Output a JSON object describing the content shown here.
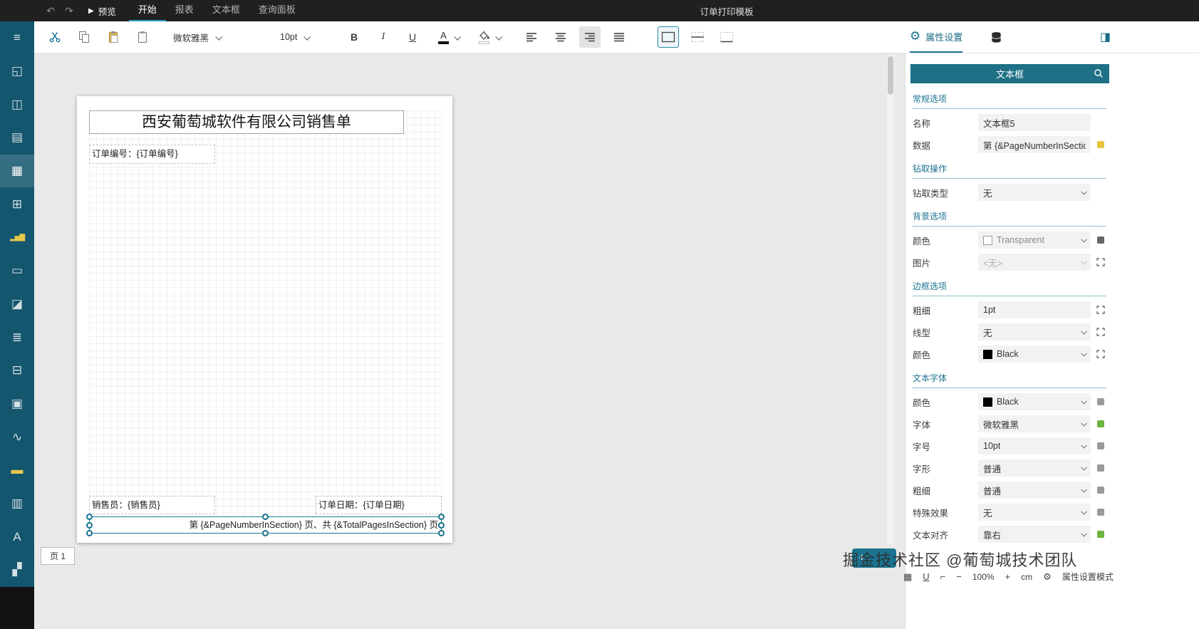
{
  "colors": {
    "accent_teal": "#1b7390",
    "topbar_bg": "#202020",
    "rail_bg": "#14566e",
    "selection": "#1f7c97",
    "chip_yellow": "#e5c63d",
    "chip_green": "#6cb33f"
  },
  "topbar": {
    "preview": "预览",
    "tabs": [
      {
        "label": "开始"
      },
      {
        "label": "报表"
      },
      {
        "label": "文本框"
      },
      {
        "label": "查询面板"
      }
    ],
    "title": "订单打印模板"
  },
  "toolbar": {
    "font_family": "微软雅黑",
    "font_size": "10pt",
    "bold": "B",
    "italic": "I",
    "underline": "U"
  },
  "panel": {
    "header_tab": "属性设置",
    "title": "文本框",
    "groups": [
      {
        "title": "常规选项",
        "rows": [
          {
            "label": "名称",
            "value": "文本框5"
          },
          {
            "label": "数据",
            "value": "第 {&PageNumberInSectio"
          }
        ]
      },
      {
        "title": "钻取操作",
        "rows": [
          {
            "label": "钻取类型",
            "value": "无"
          }
        ]
      },
      {
        "title": "背景选项",
        "rows": [
          {
            "label": "颜色",
            "value": "Transparent"
          },
          {
            "label": "图片",
            "value": "<无>"
          }
        ]
      },
      {
        "title": "边框选项",
        "rows": [
          {
            "label": "粗细",
            "value": "1pt"
          },
          {
            "label": "线型",
            "value": "无"
          },
          {
            "label": "颜色",
            "value": "Black"
          }
        ]
      },
      {
        "title": "文本字体",
        "rows": [
          {
            "label": "颜色",
            "value": "Black"
          },
          {
            "label": "字体",
            "value": "微软雅黑"
          },
          {
            "label": "字号",
            "value": "10pt"
          },
          {
            "label": "字形",
            "value": "普通"
          },
          {
            "label": "粗细",
            "value": "普通"
          },
          {
            "label": "特殊效果",
            "value": "无"
          },
          {
            "label": "文本对齐",
            "value": "靠右"
          }
        ]
      }
    ]
  },
  "canvas": {
    "report_title": "西安葡萄城软件有限公司销售单",
    "order_no": "订单编号：{订单编号}",
    "seller": "销售员：{销售员}",
    "order_date": "订单日期：{订单日期}",
    "page_footer": "第 {&PageNumberInSection} 页、共 {&TotalPagesInSection} 页"
  },
  "bottom": {
    "page_tab": "页 1",
    "zoom": "100%",
    "unit": "cm",
    "mode": "属性设置模式",
    "watermark": "掘金技术社区 @葡萄城技术团队"
  },
  "icons": {
    "menu": "≡",
    "report_explorer": "◱",
    "layout": "◫",
    "layers": "▤",
    "table": "▦",
    "grid": "⊞",
    "chart": "▂▅▇",
    "textbox": "▭",
    "image": "◪",
    "list": "≣",
    "matrix": "⊟",
    "subreport": "▣",
    "sparkline": "∿",
    "input_box": "▬",
    "barcode": "▥",
    "richtext": "A",
    "pattern": "▞",
    "undo": "↶",
    "redo": "↷",
    "play": "▶",
    "gear": "⚙",
    "collapse_right": "◨",
    "status_grid": "▦",
    "status_u": "U",
    "status_ruler": "⌐",
    "zoom_out": "−",
    "zoom_in": "+",
    "add": "+"
  }
}
